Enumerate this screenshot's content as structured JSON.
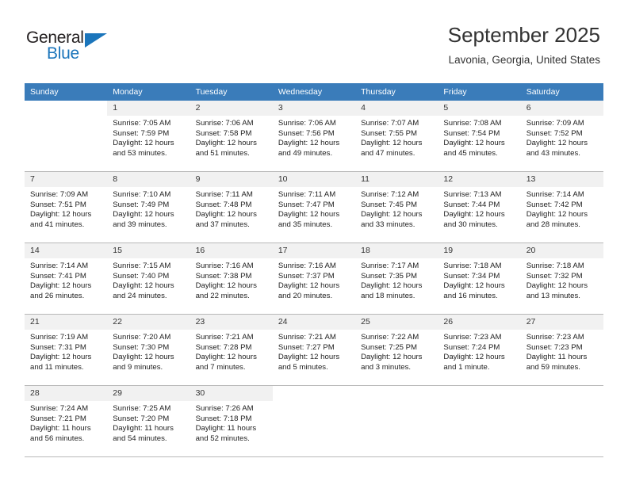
{
  "brand": {
    "name_part1": "General",
    "name_part2": "Blue",
    "accent_color": "#1b75bb",
    "triangle_icon": "triangle-icon"
  },
  "header": {
    "title": "September 2025",
    "subtitle": "Lavonia, Georgia, United States",
    "header_bg_color": "#3a7cba"
  },
  "weekdays": [
    "Sunday",
    "Monday",
    "Tuesday",
    "Wednesday",
    "Thursday",
    "Friday",
    "Saturday"
  ],
  "weeks": [
    [
      {
        "day": "",
        "sunrise": "",
        "sunset": "",
        "daylight1": "",
        "daylight2": "",
        "blank": true
      },
      {
        "day": "1",
        "sunrise": "Sunrise: 7:05 AM",
        "sunset": "Sunset: 7:59 PM",
        "daylight1": "Daylight: 12 hours",
        "daylight2": "and 53 minutes."
      },
      {
        "day": "2",
        "sunrise": "Sunrise: 7:06 AM",
        "sunset": "Sunset: 7:58 PM",
        "daylight1": "Daylight: 12 hours",
        "daylight2": "and 51 minutes."
      },
      {
        "day": "3",
        "sunrise": "Sunrise: 7:06 AM",
        "sunset": "Sunset: 7:56 PM",
        "daylight1": "Daylight: 12 hours",
        "daylight2": "and 49 minutes."
      },
      {
        "day": "4",
        "sunrise": "Sunrise: 7:07 AM",
        "sunset": "Sunset: 7:55 PM",
        "daylight1": "Daylight: 12 hours",
        "daylight2": "and 47 minutes."
      },
      {
        "day": "5",
        "sunrise": "Sunrise: 7:08 AM",
        "sunset": "Sunset: 7:54 PM",
        "daylight1": "Daylight: 12 hours",
        "daylight2": "and 45 minutes."
      },
      {
        "day": "6",
        "sunrise": "Sunrise: 7:09 AM",
        "sunset": "Sunset: 7:52 PM",
        "daylight1": "Daylight: 12 hours",
        "daylight2": "and 43 minutes."
      }
    ],
    [
      {
        "day": "7",
        "sunrise": "Sunrise: 7:09 AM",
        "sunset": "Sunset: 7:51 PM",
        "daylight1": "Daylight: 12 hours",
        "daylight2": "and 41 minutes."
      },
      {
        "day": "8",
        "sunrise": "Sunrise: 7:10 AM",
        "sunset": "Sunset: 7:49 PM",
        "daylight1": "Daylight: 12 hours",
        "daylight2": "and 39 minutes."
      },
      {
        "day": "9",
        "sunrise": "Sunrise: 7:11 AM",
        "sunset": "Sunset: 7:48 PM",
        "daylight1": "Daylight: 12 hours",
        "daylight2": "and 37 minutes."
      },
      {
        "day": "10",
        "sunrise": "Sunrise: 7:11 AM",
        "sunset": "Sunset: 7:47 PM",
        "daylight1": "Daylight: 12 hours",
        "daylight2": "and 35 minutes."
      },
      {
        "day": "11",
        "sunrise": "Sunrise: 7:12 AM",
        "sunset": "Sunset: 7:45 PM",
        "daylight1": "Daylight: 12 hours",
        "daylight2": "and 33 minutes."
      },
      {
        "day": "12",
        "sunrise": "Sunrise: 7:13 AM",
        "sunset": "Sunset: 7:44 PM",
        "daylight1": "Daylight: 12 hours",
        "daylight2": "and 30 minutes."
      },
      {
        "day": "13",
        "sunrise": "Sunrise: 7:14 AM",
        "sunset": "Sunset: 7:42 PM",
        "daylight1": "Daylight: 12 hours",
        "daylight2": "and 28 minutes."
      }
    ],
    [
      {
        "day": "14",
        "sunrise": "Sunrise: 7:14 AM",
        "sunset": "Sunset: 7:41 PM",
        "daylight1": "Daylight: 12 hours",
        "daylight2": "and 26 minutes."
      },
      {
        "day": "15",
        "sunrise": "Sunrise: 7:15 AM",
        "sunset": "Sunset: 7:40 PM",
        "daylight1": "Daylight: 12 hours",
        "daylight2": "and 24 minutes."
      },
      {
        "day": "16",
        "sunrise": "Sunrise: 7:16 AM",
        "sunset": "Sunset: 7:38 PM",
        "daylight1": "Daylight: 12 hours",
        "daylight2": "and 22 minutes."
      },
      {
        "day": "17",
        "sunrise": "Sunrise: 7:16 AM",
        "sunset": "Sunset: 7:37 PM",
        "daylight1": "Daylight: 12 hours",
        "daylight2": "and 20 minutes."
      },
      {
        "day": "18",
        "sunrise": "Sunrise: 7:17 AM",
        "sunset": "Sunset: 7:35 PM",
        "daylight1": "Daylight: 12 hours",
        "daylight2": "and 18 minutes."
      },
      {
        "day": "19",
        "sunrise": "Sunrise: 7:18 AM",
        "sunset": "Sunset: 7:34 PM",
        "daylight1": "Daylight: 12 hours",
        "daylight2": "and 16 minutes."
      },
      {
        "day": "20",
        "sunrise": "Sunrise: 7:18 AM",
        "sunset": "Sunset: 7:32 PM",
        "daylight1": "Daylight: 12 hours",
        "daylight2": "and 13 minutes."
      }
    ],
    [
      {
        "day": "21",
        "sunrise": "Sunrise: 7:19 AM",
        "sunset": "Sunset: 7:31 PM",
        "daylight1": "Daylight: 12 hours",
        "daylight2": "and 11 minutes."
      },
      {
        "day": "22",
        "sunrise": "Sunrise: 7:20 AM",
        "sunset": "Sunset: 7:30 PM",
        "daylight1": "Daylight: 12 hours",
        "daylight2": "and 9 minutes."
      },
      {
        "day": "23",
        "sunrise": "Sunrise: 7:21 AM",
        "sunset": "Sunset: 7:28 PM",
        "daylight1": "Daylight: 12 hours",
        "daylight2": "and 7 minutes."
      },
      {
        "day": "24",
        "sunrise": "Sunrise: 7:21 AM",
        "sunset": "Sunset: 7:27 PM",
        "daylight1": "Daylight: 12 hours",
        "daylight2": "and 5 minutes."
      },
      {
        "day": "25",
        "sunrise": "Sunrise: 7:22 AM",
        "sunset": "Sunset: 7:25 PM",
        "daylight1": "Daylight: 12 hours",
        "daylight2": "and 3 minutes."
      },
      {
        "day": "26",
        "sunrise": "Sunrise: 7:23 AM",
        "sunset": "Sunset: 7:24 PM",
        "daylight1": "Daylight: 12 hours",
        "daylight2": "and 1 minute."
      },
      {
        "day": "27",
        "sunrise": "Sunrise: 7:23 AM",
        "sunset": "Sunset: 7:23 PM",
        "daylight1": "Daylight: 11 hours",
        "daylight2": "and 59 minutes."
      }
    ],
    [
      {
        "day": "28",
        "sunrise": "Sunrise: 7:24 AM",
        "sunset": "Sunset: 7:21 PM",
        "daylight1": "Daylight: 11 hours",
        "daylight2": "and 56 minutes."
      },
      {
        "day": "29",
        "sunrise": "Sunrise: 7:25 AM",
        "sunset": "Sunset: 7:20 PM",
        "daylight1": "Daylight: 11 hours",
        "daylight2": "and 54 minutes."
      },
      {
        "day": "30",
        "sunrise": "Sunrise: 7:26 AM",
        "sunset": "Sunset: 7:18 PM",
        "daylight1": "Daylight: 11 hours",
        "daylight2": "and 52 minutes."
      },
      {
        "day": "",
        "sunrise": "",
        "sunset": "",
        "daylight1": "",
        "daylight2": "",
        "blank": true
      },
      {
        "day": "",
        "sunrise": "",
        "sunset": "",
        "daylight1": "",
        "daylight2": "",
        "blank": true
      },
      {
        "day": "",
        "sunrise": "",
        "sunset": "",
        "daylight1": "",
        "daylight2": "",
        "blank": true
      },
      {
        "day": "",
        "sunrise": "",
        "sunset": "",
        "daylight1": "",
        "daylight2": "",
        "blank": true
      }
    ]
  ]
}
